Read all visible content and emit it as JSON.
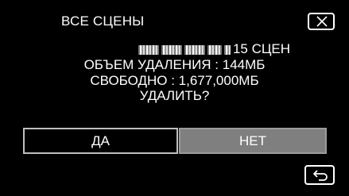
{
  "dialog": {
    "title": "ВСЕ СЦЕНЫ",
    "count_text": "15 СЦЕН",
    "size_text": "ОБЪЕМ УДАЛЕНИЯ : 144МБ",
    "free_text": "СВОБОДНО : 1,677,000МБ",
    "question": "УДАЛИТЬ?"
  },
  "buttons": {
    "yes_label": "ДА",
    "no_label": "НЕТ"
  },
  "icons": {
    "close": "close-icon",
    "back": "return-arrow-icon"
  },
  "colors": {
    "background": "#000000",
    "text": "#ffffff",
    "yes_button_bg": "#000000",
    "no_button_bg": "#7f7f7f",
    "button_border": "#bfbfbf"
  }
}
